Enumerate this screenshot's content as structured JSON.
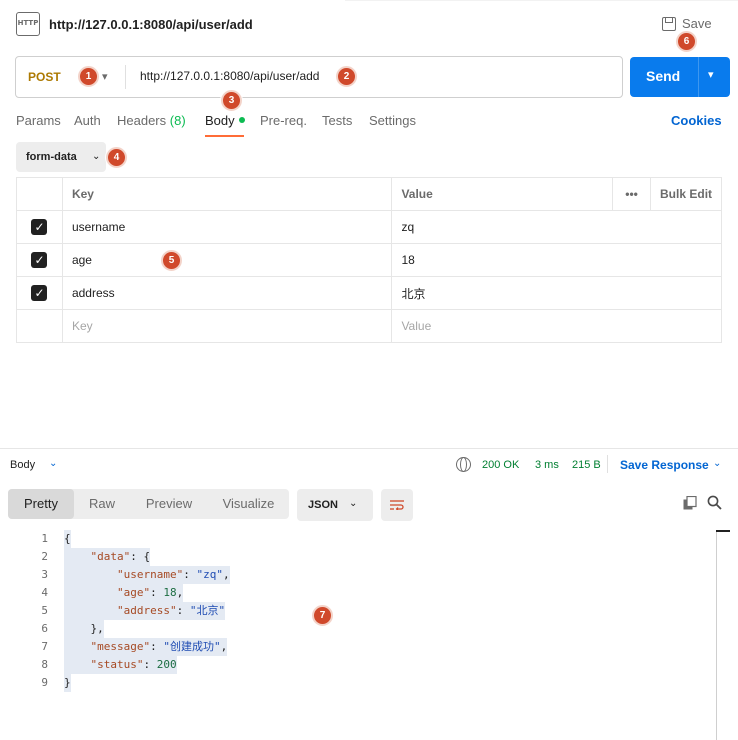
{
  "header": {
    "tab_icon_text": "HTTP",
    "tab_title": "http://127.0.0.1:8080/api/user/add",
    "save_label": "Save"
  },
  "request": {
    "method": "POST",
    "url": "http://127.0.0.1:8080/api/user/add",
    "send_label": "Send"
  },
  "req_tabs": {
    "params": "Params",
    "auth": "Auth",
    "headers": "Headers",
    "headers_count": "(8)",
    "body": "Body",
    "prereq": "Pre-req.",
    "tests": "Tests",
    "settings": "Settings",
    "cookies": "Cookies"
  },
  "body_type": "form-data",
  "kv_table": {
    "headers": {
      "key": "Key",
      "value": "Value",
      "more": "•••",
      "bulk_edit": "Bulk Edit"
    },
    "rows": [
      {
        "checked": true,
        "key": "username",
        "value": "zq"
      },
      {
        "checked": true,
        "key": "age",
        "value": "18"
      },
      {
        "checked": true,
        "key": "address",
        "value": "北京"
      }
    ],
    "placeholder_key": "Key",
    "placeholder_value": "Value"
  },
  "response": {
    "section_label": "Body",
    "status": "200 OK",
    "time": "3 ms",
    "size": "215 B",
    "save_response_label": "Save Response",
    "view_tabs": [
      "Pretty",
      "Raw",
      "Preview",
      "Visualize"
    ],
    "active_view": "Pretty",
    "format": "JSON",
    "code_lines": [
      {
        "n": "1",
        "parts": [
          [
            "p",
            "{"
          ]
        ]
      },
      {
        "n": "2",
        "parts": [
          [
            "p",
            "    "
          ],
          [
            "k",
            "\"data\""
          ],
          [
            "p",
            ": {"
          ]
        ]
      },
      {
        "n": "3",
        "parts": [
          [
            "p",
            "        "
          ],
          [
            "k",
            "\"username\""
          ],
          [
            "p",
            ": "
          ],
          [
            "s",
            "\"zq\""
          ],
          [
            "p",
            ","
          ]
        ]
      },
      {
        "n": "4",
        "parts": [
          [
            "p",
            "        "
          ],
          [
            "k",
            "\"age\""
          ],
          [
            "p",
            ": "
          ],
          [
            "n",
            "18"
          ],
          [
            "p",
            ","
          ]
        ]
      },
      {
        "n": "5",
        "parts": [
          [
            "p",
            "        "
          ],
          [
            "k",
            "\"address\""
          ],
          [
            "p",
            ": "
          ],
          [
            "s",
            "\"北京\""
          ]
        ]
      },
      {
        "n": "6",
        "parts": [
          [
            "p",
            "    },"
          ]
        ]
      },
      {
        "n": "7",
        "parts": [
          [
            "p",
            "    "
          ],
          [
            "k",
            "\"message\""
          ],
          [
            "p",
            ": "
          ],
          [
            "s",
            "\"创建成功\""
          ],
          [
            "p",
            ","
          ]
        ]
      },
      {
        "n": "8",
        "parts": [
          [
            "p",
            "    "
          ],
          [
            "k",
            "\"status\""
          ],
          [
            "p",
            ": "
          ],
          [
            "n",
            "200"
          ]
        ]
      },
      {
        "n": "9",
        "parts": [
          [
            "p",
            "}"
          ]
        ]
      }
    ]
  },
  "annotations": [
    "1",
    "2",
    "3",
    "4",
    "5",
    "6",
    "7"
  ],
  "colors": {
    "accent": "#097bed",
    "method_post": "#ad7a03",
    "active_tab_underline": "#ff6c37",
    "status_ok": "#007f31",
    "annotation_badge": "#d0492b"
  }
}
